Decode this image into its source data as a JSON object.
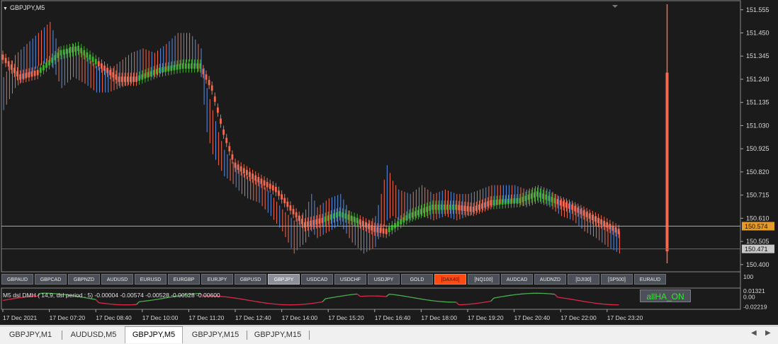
{
  "chart_window": {
    "symbol_title": "GBPJPY,M5",
    "current_price_label": "150.574",
    "bid_price_label": "150.471"
  },
  "colors": {
    "background": "#1b1b1b",
    "bull_trend": "#3cb52e",
    "bear_trend": "#f46a50",
    "candle_up": "#5b8fe6",
    "candle_down": "#f46a50",
    "price_line": "#e59a2a",
    "indicator_green": "#4caf50",
    "indicator_red": "#e0284a"
  },
  "symbol_buttons": [
    {
      "label": "GBPAUD",
      "state": "normal"
    },
    {
      "label": "GBPCAD",
      "state": "normal"
    },
    {
      "label": "GBPNZD",
      "state": "normal"
    },
    {
      "label": "AUDUSD",
      "state": "normal"
    },
    {
      "label": "EURUSD",
      "state": "normal"
    },
    {
      "label": "EURGBP",
      "state": "normal"
    },
    {
      "label": "EURJPY",
      "state": "normal"
    },
    {
      "label": "GBPUSD",
      "state": "normal"
    },
    {
      "label": "GBPJPY",
      "state": "active"
    },
    {
      "label": "USDCAD",
      "state": "normal"
    },
    {
      "label": "USDCHF",
      "state": "normal"
    },
    {
      "label": "USDJPY",
      "state": "normal"
    },
    {
      "label": "GOLD",
      "state": "normal"
    },
    {
      "label": "[DAX40]",
      "state": "hot"
    },
    {
      "label": "[NQ100]",
      "state": "normal"
    },
    {
      "label": "AUDCAD",
      "state": "normal"
    },
    {
      "label": "AUDNZD",
      "state": "normal"
    },
    {
      "label": "[DJI30]",
      "state": "normal"
    },
    {
      "label": "[SP500]",
      "state": "normal"
    },
    {
      "label": "EURAUD",
      "state": "normal"
    }
  ],
  "indicator": {
    "label": "M5 dsl DMH ( 14,9, dsl period : 5) -0.00004 -0.00574 -0.00528 -0.00528 -0.00600",
    "button_label": "allHA_ON",
    "axis_ticks": [
      "100",
      "0.01321",
      "0.00",
      "-0.02219"
    ],
    "ylim": [
      -0.028,
      0.018
    ]
  },
  "tabs": [
    {
      "label": "GBPJPY,M1",
      "active": false
    },
    {
      "label": "AUDUSD,M5",
      "active": false
    },
    {
      "label": "GBPJPY,M5",
      "active": true
    },
    {
      "label": "GBPJPY,M15",
      "active": false
    },
    {
      "label": "GBPJPY,M15",
      "active": false
    }
  ],
  "chart_data": {
    "type": "candlestick",
    "symbol": "GBPJPY",
    "timeframe": "M5",
    "ylim": [
      150.38,
      151.58
    ],
    "price_ticks": [
      151.555,
      151.45,
      151.345,
      151.24,
      151.135,
      151.03,
      150.925,
      150.82,
      150.715,
      150.61,
      150.505,
      150.4
    ],
    "price_tick_labels": [
      "151.555",
      "151.450",
      "151.345",
      "151.240",
      "151.135",
      "151.030",
      "150.925",
      "150.820",
      "150.715",
      "150.610",
      "150.505",
      "150.400"
    ],
    "time_labels": [
      "17 Dec 2021",
      "17 Dec 07:20",
      "17 Dec 08:40",
      "17 Dec 10:00",
      "17 Dec 11:20",
      "17 Dec 12:40",
      "17 Dec 14:00",
      "17 Dec 15:20",
      "17 Dec 16:40",
      "17 Dec 18:00",
      "17 Dec 19:20",
      "17 Dec 20:40",
      "17 Dec 22:00",
      "17 Dec 23:20"
    ],
    "time_label_bar_index": [
      0,
      16,
      32,
      48,
      64,
      80,
      96,
      112,
      128,
      144,
      160,
      176,
      192,
      208
    ],
    "current_price": 150.574,
    "bid_price": 150.471,
    "trend_path": [
      [
        0,
        151.34,
        -1
      ],
      [
        6,
        151.25,
        -1
      ],
      [
        12,
        151.27,
        1
      ],
      [
        20,
        151.36,
        1
      ],
      [
        26,
        151.38,
        1
      ],
      [
        32,
        151.32,
        -1
      ],
      [
        40,
        151.24,
        -1
      ],
      [
        46,
        151.24,
        1
      ],
      [
        54,
        151.28,
        1
      ],
      [
        62,
        151.3,
        1
      ],
      [
        68,
        151.3,
        -1
      ],
      [
        72,
        151.2,
        -1
      ],
      [
        76,
        151.0,
        -1
      ],
      [
        80,
        150.85,
        -1
      ],
      [
        86,
        150.8,
        -1
      ],
      [
        94,
        150.74,
        -1
      ],
      [
        100,
        150.64,
        -1
      ],
      [
        104,
        150.58,
        -1
      ],
      [
        110,
        150.6,
        1
      ],
      [
        116,
        150.63,
        1
      ],
      [
        122,
        150.6,
        -1
      ],
      [
        128,
        150.56,
        -1
      ],
      [
        132,
        150.55,
        1
      ],
      [
        140,
        150.62,
        1
      ],
      [
        148,
        150.66,
        1
      ],
      [
        156,
        150.66,
        -1
      ],
      [
        162,
        150.65,
        -1
      ],
      [
        168,
        150.68,
        1
      ],
      [
        178,
        150.69,
        1
      ],
      [
        184,
        150.72,
        1
      ],
      [
        190,
        150.69,
        -1
      ],
      [
        196,
        150.66,
        -1
      ],
      [
        202,
        150.62,
        -1
      ],
      [
        208,
        150.58,
        -1
      ],
      [
        212,
        150.55,
        -1
      ]
    ],
    "candles": [
      [
        0,
        151.1,
        151.25
      ],
      [
        4,
        151.2,
        151.35
      ],
      [
        8,
        151.25,
        151.4
      ],
      [
        12,
        151.3,
        151.45
      ],
      [
        16,
        151.32,
        151.5
      ],
      [
        20,
        151.2,
        151.35
      ],
      [
        24,
        151.25,
        151.4
      ],
      [
        28,
        151.22,
        151.35
      ],
      [
        32,
        151.18,
        151.3
      ],
      [
        36,
        151.18,
        151.28
      ],
      [
        40,
        151.2,
        151.32
      ],
      [
        44,
        151.22,
        151.36
      ],
      [
        48,
        151.25,
        151.38
      ],
      [
        52,
        151.25,
        151.36
      ],
      [
        56,
        151.28,
        151.4
      ],
      [
        60,
        151.3,
        151.45
      ],
      [
        64,
        151.32,
        151.45
      ],
      [
        66,
        151.3,
        151.42
      ],
      [
        68,
        151.25,
        151.38
      ],
      [
        70,
        151.0,
        151.2
      ],
      [
        72,
        150.9,
        151.1
      ],
      [
        74,
        150.85,
        151.0
      ],
      [
        76,
        150.8,
        150.92
      ],
      [
        78,
        150.78,
        150.88
      ],
      [
        80,
        150.75,
        150.85
      ],
      [
        82,
        150.72,
        150.82
      ],
      [
        84,
        150.7,
        150.8
      ],
      [
        88,
        150.68,
        150.78
      ],
      [
        92,
        150.62,
        150.72
      ],
      [
        96,
        150.55,
        150.65
      ],
      [
        100,
        150.45,
        150.6
      ],
      [
        102,
        150.48,
        150.62
      ],
      [
        104,
        150.5,
        150.65
      ],
      [
        106,
        150.55,
        150.72
      ],
      [
        108,
        150.52,
        150.66
      ],
      [
        112,
        150.55,
        150.7
      ],
      [
        116,
        150.58,
        150.72
      ],
      [
        120,
        150.5,
        150.62
      ],
      [
        124,
        150.45,
        150.58
      ],
      [
        128,
        150.48,
        150.62
      ],
      [
        130,
        150.55,
        150.72
      ],
      [
        132,
        150.6,
        150.85
      ],
      [
        134,
        150.62,
        150.78
      ],
      [
        136,
        150.6,
        150.74
      ],
      [
        140,
        150.6,
        150.72
      ],
      [
        144,
        150.62,
        150.76
      ],
      [
        148,
        150.6,
        150.72
      ],
      [
        152,
        150.62,
        150.74
      ],
      [
        156,
        150.6,
        150.72
      ],
      [
        160,
        150.62,
        150.72
      ],
      [
        164,
        150.64,
        150.74
      ],
      [
        168,
        150.66,
        150.76
      ],
      [
        172,
        150.68,
        150.76
      ],
      [
        176,
        150.68,
        150.76
      ],
      [
        180,
        150.66,
        150.74
      ],
      [
        184,
        150.68,
        150.76
      ],
      [
        188,
        150.66,
        150.74
      ],
      [
        192,
        150.62,
        150.7
      ],
      [
        196,
        150.6,
        150.68
      ],
      [
        200,
        150.55,
        150.65
      ],
      [
        204,
        150.52,
        150.62
      ],
      [
        208,
        150.48,
        150.58
      ],
      [
        212,
        150.45,
        150.55
      ]
    ]
  }
}
